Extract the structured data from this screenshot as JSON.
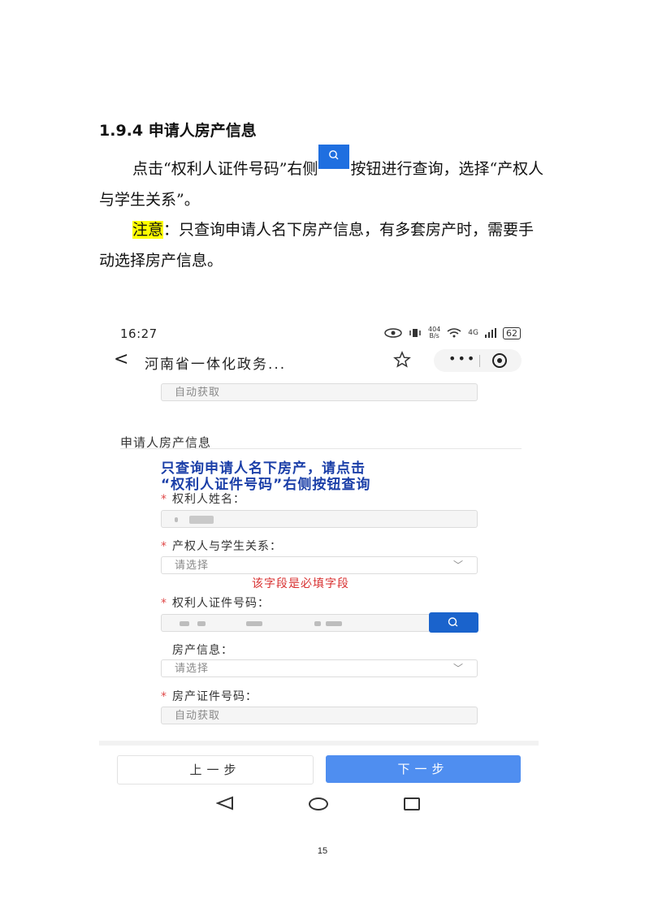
{
  "doc": {
    "heading": "1.9.4 申请人房产信息",
    "para1_before": "点击“权利人证件号码”右侧",
    "para1_after": "按钮进行查询，选择“产权人与学生关系”。",
    "note_label": "注意",
    "note_text": "：只查询申请人名下房产信息，有多套房产时，需要手动选择房产信息。",
    "page_number": "15"
  },
  "phone": {
    "status_time": "16:27",
    "status_speed_top": "404",
    "status_speed_bottom": "B/s",
    "status_network": "4G",
    "battery": "62",
    "back_glyph": "<",
    "app_title": "河南省一体化政务...",
    "more_glyph": "•••",
    "top_field_value": "自动获取",
    "section_title": "申请人房产信息",
    "notice_line1": "只查询申请人名下房产，请点击",
    "notice_line2": "“权利人证件号码”右侧按钮查询",
    "required_mark": "*",
    "owner_name_label": "权利人姓名：",
    "relation_label": "产权人与学生关系：",
    "relation_placeholder": "请选择",
    "relation_error": "该字段是必填字段",
    "id_number_label": "权利人证件号码：",
    "property_info_label": "房产信息：",
    "property_info_placeholder": "请选择",
    "cert_number_label": "房产证件号码：",
    "cert_number_value": "自动获取",
    "prev_button": "上一步",
    "next_button": "下一步"
  },
  "colors": {
    "query_button": "#1a63cc",
    "next_button": "#4f8ef0",
    "notice_text": "#1b3fa8",
    "error_text": "#d83030",
    "highlight": "#ffff00"
  }
}
